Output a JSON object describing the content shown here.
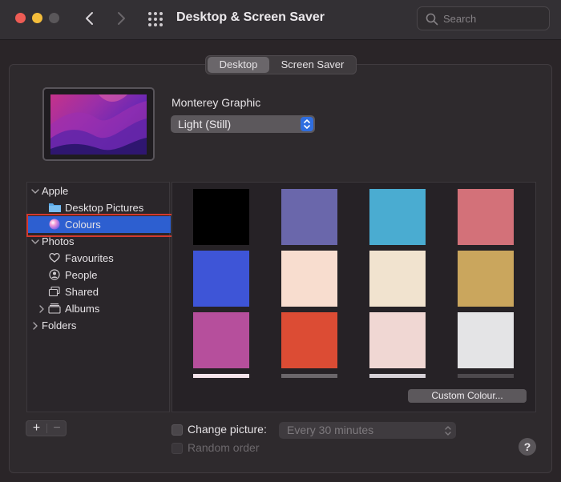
{
  "window": {
    "title": "Desktop & Screen Saver",
    "search_placeholder": "Search"
  },
  "tabs": [
    {
      "label": "Desktop",
      "selected": true
    },
    {
      "label": "Screen Saver",
      "selected": false
    }
  ],
  "current_wallpaper": {
    "name": "Monterey Graphic",
    "mode": "Light (Still)"
  },
  "sidebar": {
    "apple_label": "Apple",
    "desktop_pictures_label": "Desktop Pictures",
    "colours_label": "Colours",
    "photos_label": "Photos",
    "favourites_label": "Favourites",
    "people_label": "People",
    "shared_label": "Shared",
    "albums_label": "Albums",
    "folders_label": "Folders",
    "selected": "Colours"
  },
  "swatches": [
    {
      "color": "#000000"
    },
    {
      "color": "#6a67ab"
    },
    {
      "color": "#4aacd1"
    },
    {
      "color": "#d37179"
    },
    {
      "color": "#3e55d7"
    },
    {
      "color": "#f8ddcf"
    },
    {
      "color": "#f1e3cf"
    },
    {
      "color": "#caa65d"
    },
    {
      "color": "#b64f9c"
    },
    {
      "color": "#dc4c34"
    },
    {
      "color": "#f0d7d3"
    },
    {
      "color": "#e4e4e6"
    }
  ],
  "swatch_strips": [
    {
      "color": "#f4e4ea"
    },
    {
      "color": "#6b676b"
    },
    {
      "color": "#d5d0d6"
    },
    {
      "color": "#4d494d"
    }
  ],
  "custom_colour_button": "Custom Colour...",
  "add_label": "+",
  "remove_label": "−",
  "change_picture": {
    "label": "Change picture:",
    "checked": false,
    "interval": "Every 30 minutes"
  },
  "random_order": {
    "label": "Random order",
    "checked": false,
    "enabled": false
  },
  "help_label": "?"
}
